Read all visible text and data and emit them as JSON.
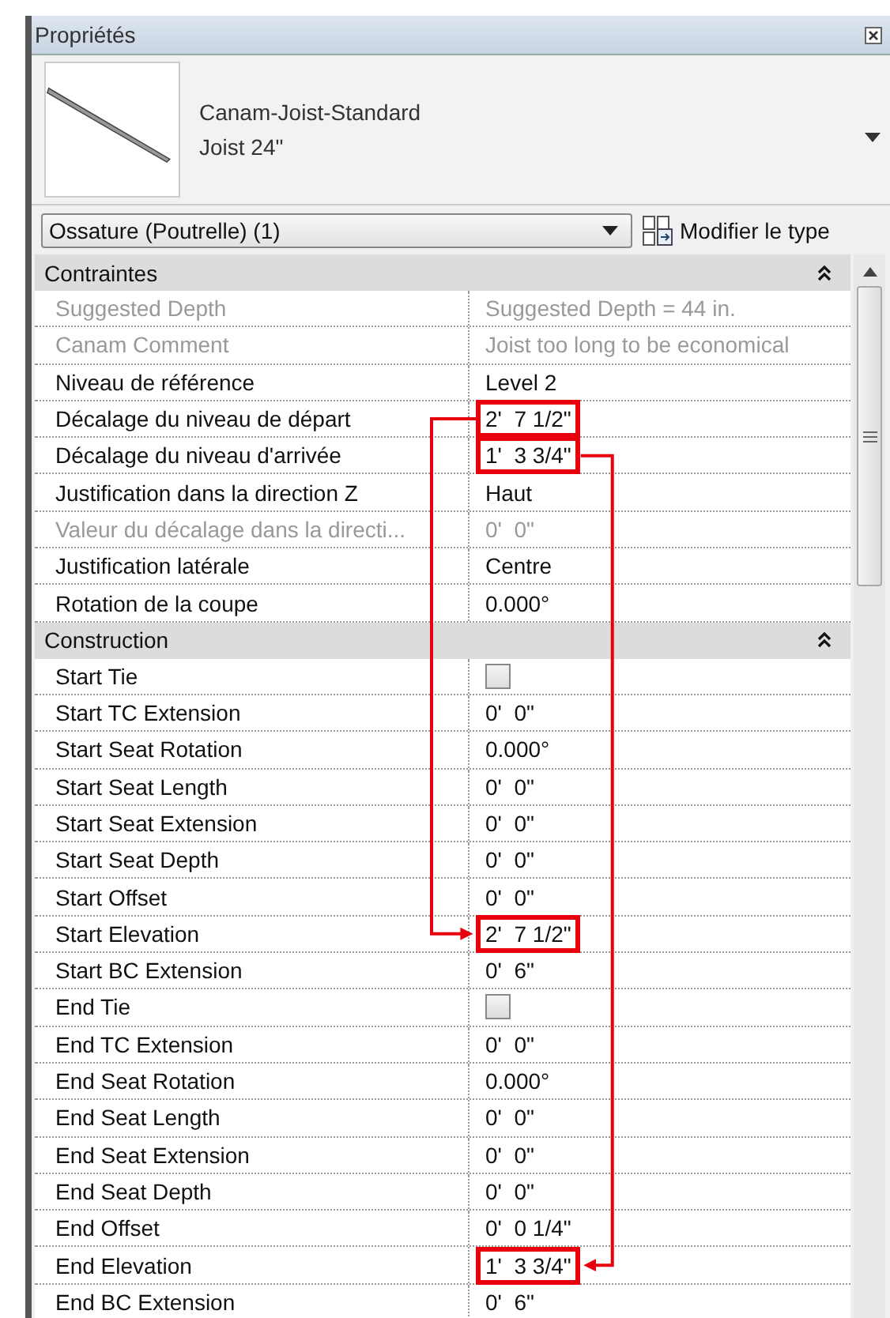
{
  "panel": {
    "title": "Propriétés"
  },
  "type_selector": {
    "family": "Canam-Joist-Standard",
    "type": "Joist 24\""
  },
  "filter": {
    "value": "Ossature (Poutrelle) (1)"
  },
  "edit_type_button": {
    "label": "Modifier le type"
  },
  "callout_arrows": [
    {
      "kind": "left"
    },
    {
      "kind": "right"
    }
  ],
  "sections": [
    {
      "title": "Contraintes",
      "expanded": true,
      "rows": [
        {
          "label": "Suggested Depth",
          "value": "Suggested Depth = 44 in.",
          "disabled": true,
          "highlight": false
        },
        {
          "label": "Canam Comment",
          "value": "Joist too long to be economical",
          "disabled": true,
          "highlight": false
        },
        {
          "label": "Niveau de référence",
          "value": "Level 2",
          "disabled": false,
          "highlight": false
        },
        {
          "label": "Décalage du niveau de départ",
          "value": "2'  7 1/2\"",
          "disabled": false,
          "highlight": true,
          "arrow_start": true
        },
        {
          "label": "Décalage du niveau d'arrivée",
          "value": "1'  3 3/4\"",
          "disabled": false,
          "highlight": true,
          "arrow_start": true
        },
        {
          "label": "Justification dans la direction Z",
          "value": "Haut",
          "disabled": false,
          "highlight": false
        },
        {
          "label": "Valeur du décalage dans la directi...",
          "value": "0'  0\"",
          "disabled": true,
          "highlight": false
        },
        {
          "label": "Justification latérale",
          "value": "Centre",
          "disabled": false,
          "highlight": false
        },
        {
          "label": "Rotation de la coupe",
          "value": "0.000°",
          "disabled": false,
          "highlight": false
        }
      ]
    },
    {
      "title": "Construction",
      "expanded": true,
      "rows": [
        {
          "label": "Start Tie",
          "kind": "checkbox",
          "checked": false,
          "disabled": false
        },
        {
          "label": "Start TC Extension",
          "value": "0'  0\"",
          "disabled": false,
          "highlight": false
        },
        {
          "label": "Start Seat Rotation",
          "value": "0.000°",
          "disabled": false,
          "highlight": false
        },
        {
          "label": "Start Seat Length",
          "value": "0'  0\"",
          "disabled": false,
          "highlight": false
        },
        {
          "label": "Start Seat Extension",
          "value": "0'  0\"",
          "disabled": false,
          "highlight": false
        },
        {
          "label": "Start Seat Depth",
          "value": "0'  0\"",
          "disabled": false,
          "highlight": false
        },
        {
          "label": "Start Offset",
          "value": "0'  0\"",
          "disabled": false,
          "highlight": false
        },
        {
          "label": "Start Elevation",
          "value": "2'  7 1/2\"",
          "disabled": false,
          "highlight": true,
          "arrow_end": true
        },
        {
          "label": "Start BC Extension",
          "value": "0'  6\"",
          "disabled": false,
          "highlight": false
        },
        {
          "label": "End Tie",
          "kind": "checkbox",
          "checked": false,
          "disabled": false
        },
        {
          "label": "End TC Extension",
          "value": "0'  0\"",
          "disabled": false,
          "highlight": false
        },
        {
          "label": "End Seat Rotation",
          "value": "0.000°",
          "disabled": false,
          "highlight": false
        },
        {
          "label": "End Seat Length",
          "value": "0'  0\"",
          "disabled": false,
          "highlight": false
        },
        {
          "label": "End Seat Extension",
          "value": "0'  0\"",
          "disabled": false,
          "highlight": false
        },
        {
          "label": "End Seat Depth",
          "value": "0'  0\"",
          "disabled": false,
          "highlight": false
        },
        {
          "label": "End Offset",
          "value": "0'  0 1/4\"",
          "disabled": false,
          "highlight": false
        },
        {
          "label": "End Elevation",
          "value": "1'  3 3/4\"",
          "disabled": false,
          "highlight": true,
          "arrow_end": true
        },
        {
          "label": "End BC Extension",
          "value": "0'  6\"",
          "disabled": false,
          "highlight": false
        }
      ]
    }
  ]
}
